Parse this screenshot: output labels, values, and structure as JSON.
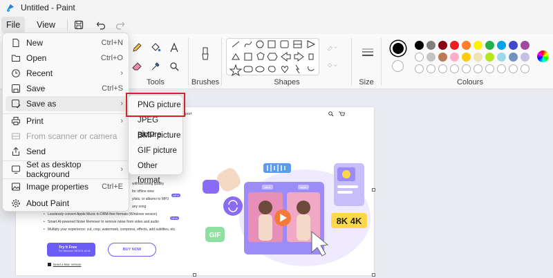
{
  "window": {
    "title": "Untitled - Paint"
  },
  "menubar": {
    "file": "File",
    "view": "View"
  },
  "ribbon": {
    "groups": {
      "tools": "Tools",
      "brushes": "Brushes",
      "shapes": "Shapes",
      "size": "Size",
      "colours": "Colours"
    }
  },
  "colors": {
    "row1": [
      "#000000",
      "#7f7f7f",
      "#880015",
      "#ed1c24",
      "#ff7f27",
      "#fff200",
      "#22b14c",
      "#00a2e8",
      "#3f48cc",
      "#a349a4"
    ],
    "row2": [
      "#ffffff",
      "#c3c3c3",
      "#b97a57",
      "#ffaec9",
      "#ffc90e",
      "#efe4b0",
      "#b5e61d",
      "#99d9ea",
      "#7092be",
      "#c8bfe7"
    ]
  },
  "file_menu": {
    "items": [
      {
        "label": "New",
        "shortcut": "Ctrl+N"
      },
      {
        "label": "Open",
        "shortcut": "Ctrl+O"
      },
      {
        "label": "Recent",
        "shortcut": ""
      },
      {
        "label": "Save",
        "shortcut": "Ctrl+S"
      },
      {
        "label": "Save as",
        "shortcut": ""
      },
      {
        "label": "Print",
        "shortcut": ""
      },
      {
        "label": "From scanner or camera",
        "shortcut": ""
      },
      {
        "label": "Send",
        "shortcut": ""
      },
      {
        "label": "Set as desktop background",
        "shortcut": ""
      },
      {
        "label": "Image properties",
        "shortcut": "Ctrl+E"
      },
      {
        "label": "About Paint",
        "shortcut": ""
      }
    ]
  },
  "save_as_menu": {
    "items": [
      "PNG picture",
      "JPEG picture",
      "BMP picture",
      "GIF picture",
      "Other format"
    ]
  },
  "canvas_page": {
    "header_fragment": "port",
    "features": [
      "without losing quality",
      "for offline view",
      "ylists, or albums to MP3",
      "any song",
      "Losslessly convert Apple Music to DRM-free formats (Windows version)",
      "Smart AI-powered Noise Remover to remove noise from video and audio",
      "Multiply your experience: cut, crop, watermark, compress, effects, add subtitles, etc."
    ],
    "new_badge": "NEW",
    "try_button": "Try It Free",
    "try_sub": "For Windows 7/8/10/11 64-bit",
    "buy_button": "BUY NOW",
    "mac_link": "Need a Mac Version",
    "art_badges": {
      "gif": "GIF",
      "res": "8K 4K",
      "tag1": "MP4",
      "tag2": "MOV"
    }
  }
}
